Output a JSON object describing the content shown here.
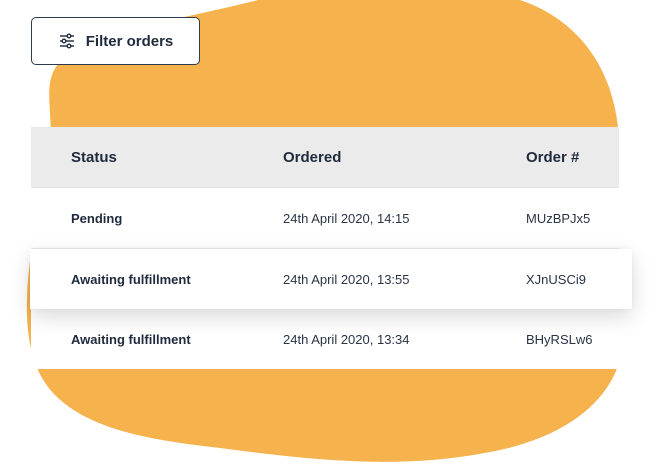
{
  "filter": {
    "label": "Filter orders",
    "icon": "sliders-icon"
  },
  "colors": {
    "blob": "#f5b24d",
    "header_bg": "#ebebeb",
    "text": "#1f2a3c",
    "border": "#2c3a4f"
  },
  "table": {
    "headers": {
      "status": "Status",
      "ordered": "Ordered",
      "order_number": "Order #"
    },
    "rows": [
      {
        "status": "Pending",
        "ordered": "24th April 2020, 14:15",
        "order_number": "MUzBPJx5"
      },
      {
        "status": "Awaiting fulfillment",
        "ordered": "24th April 2020, 13:55",
        "order_number": "XJnUSCi9"
      },
      {
        "status": "Awaiting fulfillment",
        "ordered": "24th April 2020, 13:34",
        "order_number": "BHyRSLw6"
      }
    ]
  }
}
